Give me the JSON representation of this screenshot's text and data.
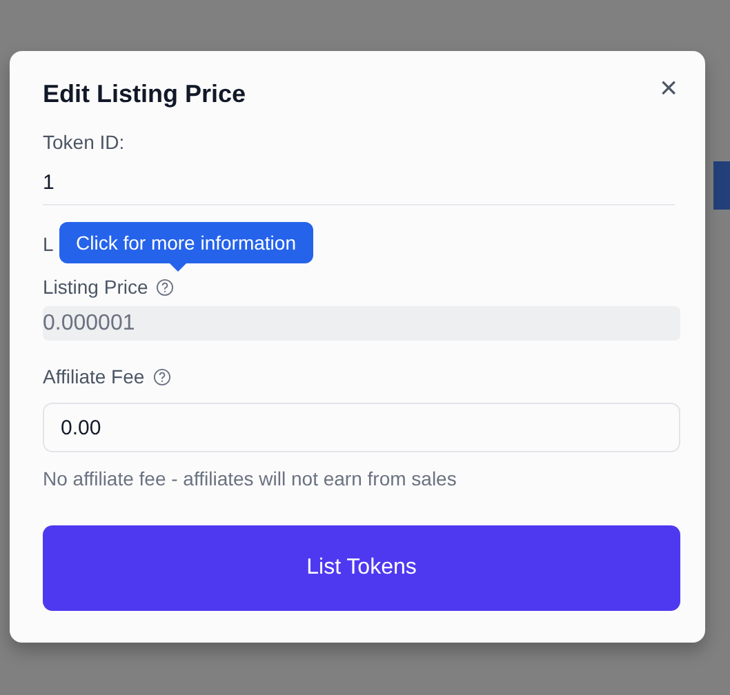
{
  "dialog": {
    "title": "Edit Listing Price",
    "close": "×"
  },
  "token_id": {
    "label": "Token ID:",
    "value": "1"
  },
  "hidden_label": "L",
  "tooltip": "Click for more information",
  "listing_price": {
    "label": "Listing Price",
    "value": "0.000001",
    "disabled": true
  },
  "affiliate_fee": {
    "label": "Affiliate Fee",
    "value": "0.00",
    "hint": "No affiliate fee - affiliates will not earn from sales"
  },
  "submit": "List Tokens"
}
